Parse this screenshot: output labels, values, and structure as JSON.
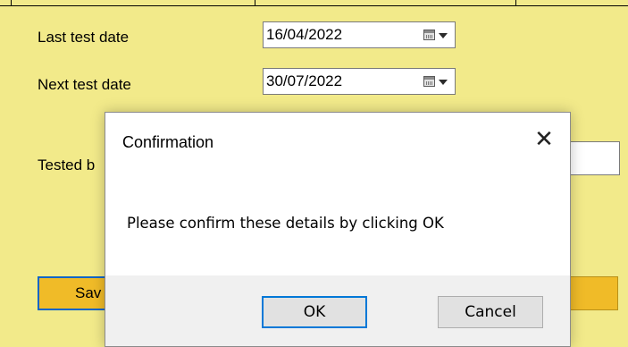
{
  "form": {
    "last_test_label": "Last test date",
    "last_test_value": "16/04/2022",
    "next_test_label": "Next test date",
    "next_test_value": "30/07/2022",
    "tested_by_label": "Tested b",
    "save_button_label": "Sav"
  },
  "dialog": {
    "title": "Confirmation",
    "close_glyph": "✕",
    "message": "Please confirm these details by clicking OK",
    "ok_label": "OK",
    "cancel_label": "Cancel"
  },
  "colors": {
    "form_background": "#f2ea8a",
    "button_yellow": "#f0bb28",
    "focus_blue": "#0078d7"
  }
}
